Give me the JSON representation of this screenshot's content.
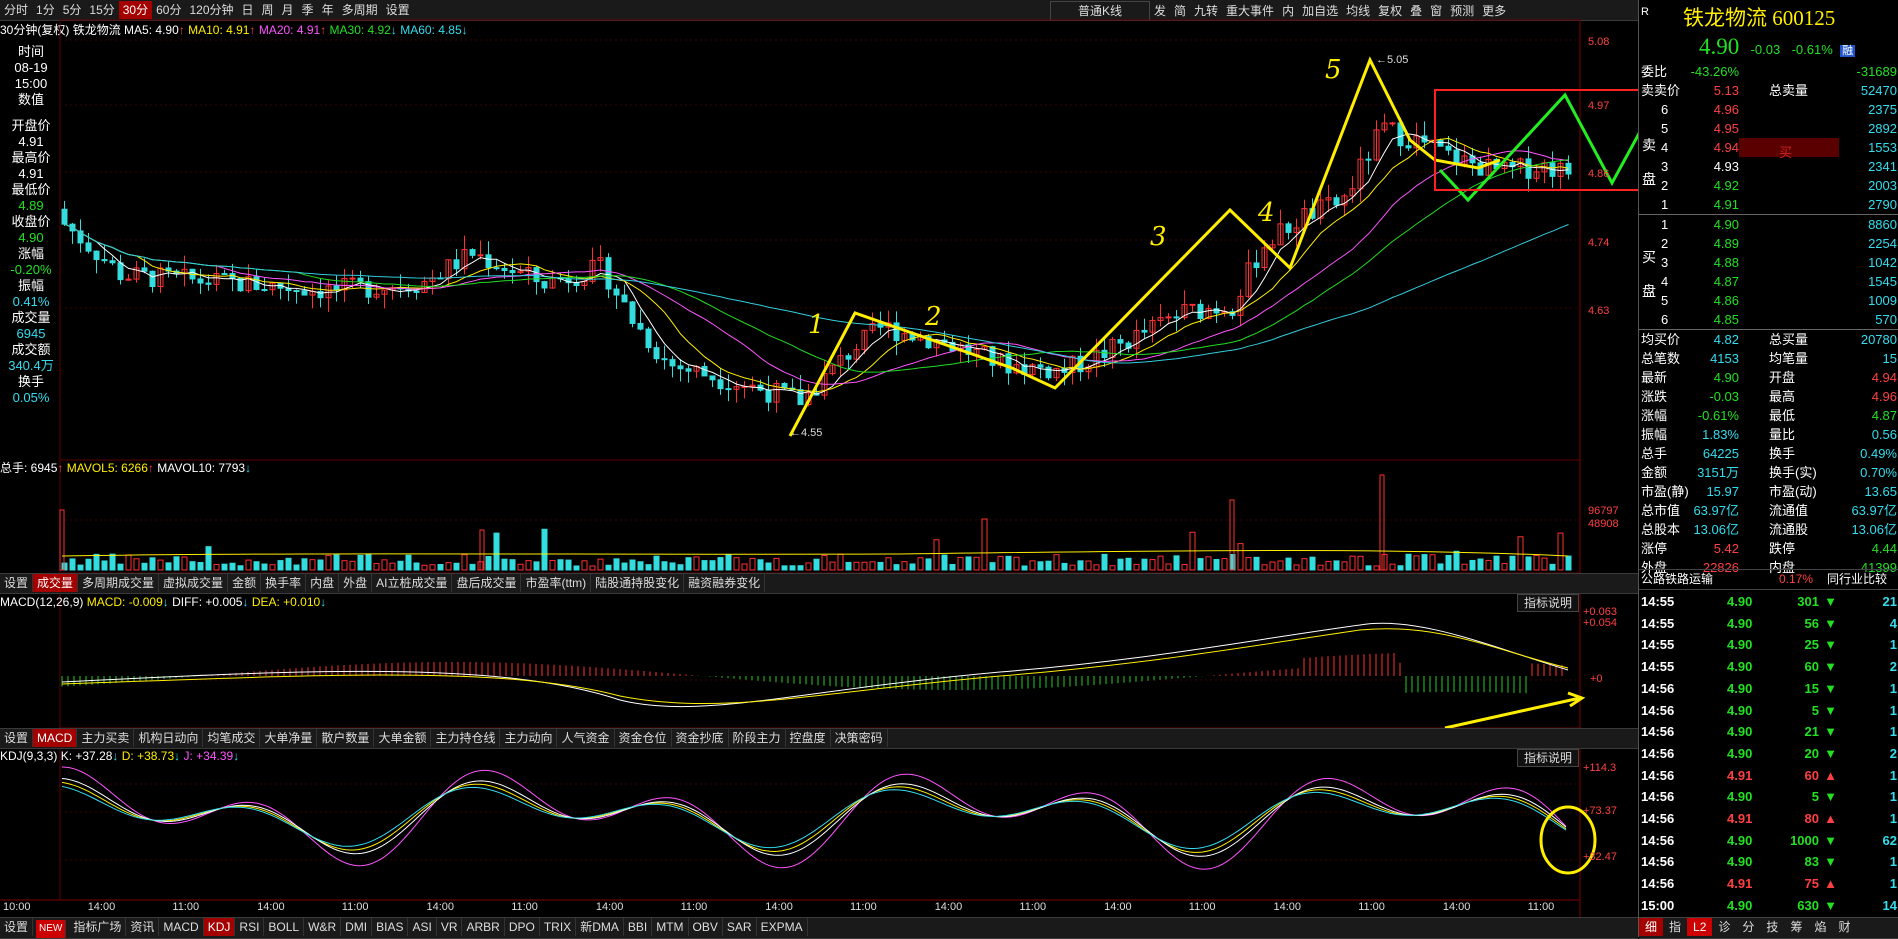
{
  "periods": [
    "分时",
    "1分",
    "5分",
    "15分",
    "30分",
    "60分",
    "120分钟",
    "日",
    "周",
    "月",
    "季",
    "年",
    "多周期",
    "设置"
  ],
  "active_period": "30分",
  "toolbar_right": {
    "kline_type": "普通K线",
    "items": [
      "发",
      "简",
      "九转",
      "重大事件",
      "内",
      "加自选",
      "均线",
      "复权",
      "叠",
      "窗",
      "预测",
      "更多"
    ]
  },
  "ma_legend": {
    "label": "30分钟(复权)",
    "name": "铁龙物流",
    "ma5": "MA5: 4.90",
    "ma10": "MA10: 4.91",
    "ma20": "MA20: 4.91",
    "ma30": "MA30: 4.92",
    "ma60": "MA60: 4.85"
  },
  "info_panel": {
    "time_label": "时间",
    "date": "08-19",
    "time": "15:00",
    "value_label": "数值",
    "items": [
      [
        "开盘价",
        "4.91"
      ],
      [
        "最高价",
        "4.91"
      ],
      [
        "最低价",
        "4.89"
      ],
      [
        "收盘价",
        "4.90"
      ],
      [
        "涨幅",
        "-0.20%"
      ],
      [
        "振幅",
        "0.41%"
      ],
      [
        "成交量",
        "6945"
      ],
      [
        "成交额",
        "340.4万"
      ],
      [
        "换手",
        "0.05%"
      ]
    ]
  },
  "price_axis": [
    "5.08",
    "4.97",
    "4.86",
    "4.74",
    "4.63"
  ],
  "annotations": {
    "high": "5.05",
    "low": "4.55",
    "waves": [
      "1",
      "2",
      "3",
      "4",
      "5"
    ]
  },
  "volume": {
    "legend_total": "总手: 6945",
    "mavol5": "MAVOL5: 6266",
    "mavol10": "MAVOL10: 7793",
    "axis": [
      "96797",
      "48908"
    ]
  },
  "tabs1": [
    "设置",
    "成交量",
    "多周期成交量",
    "虚拟成交量",
    "金额",
    "换手率",
    "内盘",
    "外盘",
    "AI立桩成交量",
    "盘后成交量",
    "市盈率(ttm)",
    "陆股通持股变化",
    "融资融券变化"
  ],
  "tabs1_active": "成交量",
  "macd": {
    "label": "MACD(12,26,9)",
    "macd": "MACD: -0.009",
    "diff": "DIFF: +0.005",
    "dea": "DEA: +0.010",
    "axis": [
      "+0.063",
      "+0.054",
      "+0"
    ],
    "help": "指标说明"
  },
  "tabs2": [
    "设置",
    "MACD",
    "主力买卖",
    "机构日动向",
    "均笔成交",
    "大单净量",
    "散户数量",
    "大单金额",
    "主力持仓线",
    "主力动向",
    "人气资金",
    "资金仓位",
    "资金抄底",
    "阶段主力",
    "控盘度",
    "决策密码"
  ],
  "tabs2_active": "MACD",
  "kdj": {
    "label": "KDJ(9,3,3)",
    "k": "K: +37.28",
    "d": "D: +38.73",
    "j": "J: +34.39",
    "axis": [
      "+114.3",
      "+73.37",
      "+32.47"
    ],
    "help": "指标说明"
  },
  "time_axis": [
    "10:00",
    "14:00",
    "11:00",
    "14:00",
    "11:00",
    "14:00",
    "11:00",
    "14:00",
    "11:00",
    "14:00",
    "11:00",
    "14:00",
    "11:00",
    "14:00",
    "11:00",
    "14:00",
    "11:00",
    "14:00",
    "11:00"
  ],
  "bottom_tabs": [
    "设置",
    "NEW",
    "指标广场",
    "资讯",
    "MACD",
    "KDJ",
    "RSI",
    "BOLL",
    "W&R",
    "DMI",
    "BIAS",
    "ASI",
    "VR",
    "ARBR",
    "DPO",
    "TRIX",
    "新DMA",
    "BBI",
    "MTM",
    "OBV",
    "SAR",
    "EXPMA"
  ],
  "bottom_active": "KDJ",
  "quote": {
    "r": "R",
    "name": "铁龙物流",
    "code": "600125",
    "price": "4.90",
    "change": "-0.03",
    "pct": "-0.61%",
    "tag": "融",
    "wb_label": "委比",
    "wb": "-43.26%",
    "wb_val": "-31689",
    "total_ask_label": "卖卖价",
    "ask_price_top": "5.13",
    "total_sell_label": "总卖量",
    "total_sell": "52470",
    "asks": [
      [
        "6",
        "4.96",
        "2375"
      ],
      [
        "5",
        "4.95",
        "2892"
      ],
      [
        "4",
        "4.94",
        "1553"
      ],
      [
        "3",
        "4.93",
        "2341"
      ],
      [
        "2",
        "4.92",
        "2003"
      ],
      [
        "1",
        "4.91",
        "2790"
      ]
    ],
    "bids": [
      [
        "1",
        "4.90",
        "8860"
      ],
      [
        "2",
        "4.89",
        "2254"
      ],
      [
        "3",
        "4.88",
        "1042"
      ],
      [
        "4",
        "4.87",
        "1545"
      ],
      [
        "5",
        "4.86",
        "1009"
      ],
      [
        "6",
        "4.85",
        "570"
      ]
    ],
    "sell_side": "卖盘",
    "buy_side": "买盘",
    "buy_mark": "买",
    "stats": [
      [
        "均买价",
        "4.82",
        "总买量",
        "20780"
      ],
      [
        "总笔数",
        "4153",
        "均笔量",
        "15"
      ],
      [
        "最新",
        "4.90",
        "开盘",
        "4.94"
      ],
      [
        "涨跌",
        "-0.03",
        "最高",
        "4.96"
      ],
      [
        "涨幅",
        "-0.61%",
        "最低",
        "4.87"
      ],
      [
        "振幅",
        "1.83%",
        "量比",
        "0.56"
      ],
      [
        "总手",
        "64225",
        "换手",
        "0.49%"
      ],
      [
        "金额",
        "3151万",
        "换手(实)",
        "0.70%"
      ],
      [
        "市盈(静)",
        "15.97",
        "市盈(动)",
        "13.65"
      ],
      [
        "总市值",
        "63.97亿",
        "流通值",
        "63.97亿"
      ],
      [
        "总股本",
        "13.06亿",
        "流通股",
        "13.06亿"
      ],
      [
        "涨停",
        "5.42",
        "跌停",
        "4.44"
      ],
      [
        "外盘",
        "22826",
        "内盘",
        "41399"
      ]
    ]
  },
  "sector": {
    "name": "公路铁路运输",
    "pct": "0.17%",
    "compare": "同行业比较"
  },
  "ticks": [
    [
      "14:55",
      "4.90",
      "301",
      "21"
    ],
    [
      "14:55",
      "4.90",
      "56",
      "4"
    ],
    [
      "14:55",
      "4.90",
      "25",
      "1"
    ],
    [
      "14:55",
      "4.90",
      "60",
      "2"
    ],
    [
      "14:56",
      "4.90",
      "15",
      "1"
    ],
    [
      "14:56",
      "4.90",
      "5",
      "1"
    ],
    [
      "14:56",
      "4.90",
      "21",
      "1"
    ],
    [
      "14:56",
      "4.90",
      "20",
      "2"
    ],
    [
      "14:56",
      "4.91",
      "60",
      "1"
    ],
    [
      "14:56",
      "4.90",
      "5",
      "1"
    ],
    [
      "14:56",
      "4.91",
      "80",
      "1"
    ],
    [
      "14:56",
      "4.90",
      "1000",
      "62"
    ],
    [
      "14:56",
      "4.90",
      "83",
      "1"
    ],
    [
      "14:56",
      "4.91",
      "75",
      "1"
    ],
    [
      "15:00",
      "4.90",
      "630",
      "14"
    ]
  ],
  "tick_dirs": [
    "d",
    "d",
    "d",
    "d",
    "d",
    "d",
    "d",
    "d",
    "u",
    "d",
    "u",
    "d",
    "d",
    "u",
    "d"
  ],
  "rp_tabs": [
    "细",
    "指",
    "L2",
    "诊",
    "分",
    "技",
    "筹",
    "焰",
    "财"
  ],
  "rp_active": "细"
}
